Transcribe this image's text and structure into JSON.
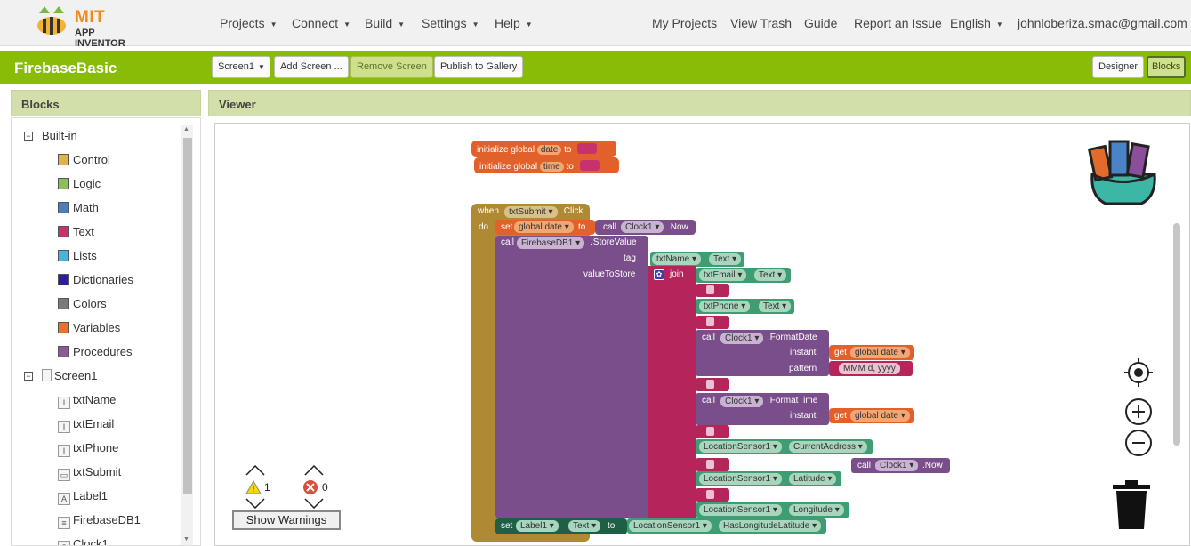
{
  "nav": {
    "logo_mit": "MIT",
    "logo_sub": "APP INVENTOR",
    "menus": [
      "Projects",
      "Connect",
      "Build",
      "Settings",
      "Help"
    ],
    "links": [
      "My Projects",
      "View Trash",
      "Guide",
      "Report an Issue"
    ],
    "language": "English",
    "account": "johnloberiza.smac@gmail.com"
  },
  "toolbar": {
    "project_name": "FirebaseBasic",
    "screen_select": "Screen1",
    "add_screen": "Add Screen ...",
    "remove_screen": "Remove Screen",
    "publish": "Publish to Gallery",
    "designer": "Designer",
    "blocks": "Blocks"
  },
  "blocks_panel": {
    "title": "Blocks",
    "builtin_label": "Built-in",
    "builtin": [
      {
        "label": "Control",
        "color": "#dfb34a"
      },
      {
        "label": "Logic",
        "color": "#8cbf58"
      },
      {
        "label": "Math",
        "color": "#4a7fbf"
      },
      {
        "label": "Text",
        "color": "#c7326c"
      },
      {
        "label": "Lists",
        "color": "#45b5e0"
      },
      {
        "label": "Dictionaries",
        "color": "#2d1e9e"
      },
      {
        "label": "Colors",
        "color": "#7a7a7a"
      },
      {
        "label": "Variables",
        "color": "#e8722b"
      },
      {
        "label": "Procedures",
        "color": "#8a5a9c"
      }
    ],
    "screen_label": "Screen1",
    "components": [
      {
        "label": "txtName",
        "icon": "I"
      },
      {
        "label": "txtEmail",
        "icon": "I"
      },
      {
        "label": "txtPhone",
        "icon": "I"
      },
      {
        "label": "txtSubmit",
        "icon": "▭"
      },
      {
        "label": "Label1",
        "icon": "A"
      },
      {
        "label": "FirebaseDB1",
        "icon": "≡"
      },
      {
        "label": "Clock1",
        "icon": "◷"
      }
    ]
  },
  "viewer": {
    "title": "Viewer",
    "warnings_count": "1",
    "errors_count": "0",
    "show_warnings": "Show Warnings"
  },
  "workspace": {
    "init1": {
      "label": "initialize global",
      "name": "date",
      "to": "to"
    },
    "init2": {
      "label": "initialize global",
      "name": "time",
      "to": "to"
    },
    "when": "when",
    "do": "do",
    "component": "txtSubmit",
    "event": ".Click",
    "set": "set",
    "to": "to",
    "call": "call",
    "get": "get",
    "join": "join",
    "global_date": "global date",
    "clock": "Clock1",
    "now": ".Now",
    "firebase": "FirebaseDB1",
    "store_value": ".StoreValue",
    "tag": "tag",
    "value_to_store": "valueToStore",
    "txtName": "txtName",
    "txtEmail": "txtEmail",
    "txtPhone": "txtPhone",
    "text": "Text",
    "format_date": ".FormatDate",
    "format_time": ".FormatTime",
    "instant": "instant",
    "pattern": "pattern",
    "pattern_value": "MMM d, yyyy",
    "location": "LocationSensor1",
    "current_address": "CurrentAddress",
    "latitude": "Latitude",
    "longitude": "Longitude",
    "label1": "Label1",
    "has_latlong": "HasLongitudeLatitude"
  }
}
